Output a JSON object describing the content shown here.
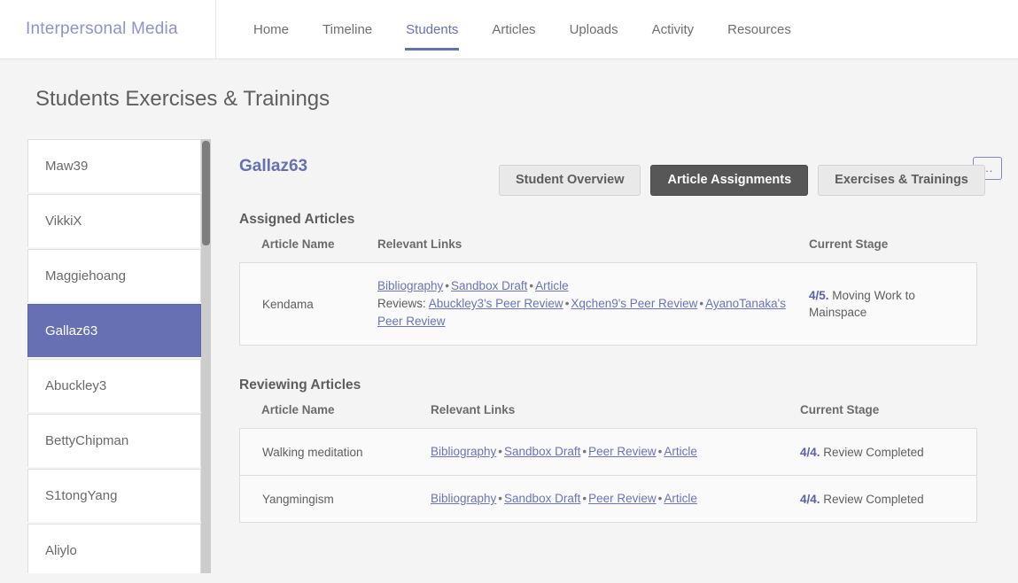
{
  "navbar": {
    "brand": "Interpersonal Media",
    "links": [
      {
        "label": "Home",
        "active": false
      },
      {
        "label": "Timeline",
        "active": false
      },
      {
        "label": "Students",
        "active": true
      },
      {
        "label": "Articles",
        "active": false
      },
      {
        "label": "Uploads",
        "active": false
      },
      {
        "label": "Activity",
        "active": false
      },
      {
        "label": "Resources",
        "active": false
      }
    ],
    "accent_color": "#6770b3"
  },
  "page": {
    "title": "Students Exercises & Trainings",
    "tabs": [
      {
        "label": "Student Overview",
        "active": false
      },
      {
        "label": "Article Assignments",
        "active": true
      },
      {
        "label": "Exercises & Trainings",
        "active": false
      }
    ]
  },
  "sidebar": {
    "students": [
      {
        "name": "Maw39",
        "selected": false
      },
      {
        "name": "VikkiX",
        "selected": false
      },
      {
        "name": "Maggiehoang",
        "selected": false
      },
      {
        "name": "Gallaz63",
        "selected": true
      },
      {
        "name": "Abuckley3",
        "selected": false
      },
      {
        "name": "BettyChipman",
        "selected": false
      },
      {
        "name": "S1tongYang",
        "selected": false
      },
      {
        "name": "Aliylo",
        "selected": false
      }
    ]
  },
  "detail": {
    "student_name": "Gallaz63",
    "more_button_label": "...",
    "assigned": {
      "section_title": "Assigned Articles",
      "headers": {
        "name": "Article Name",
        "links": "Relevant Links",
        "stage": "Current Stage"
      },
      "rows": [
        {
          "name": "Kendama",
          "links": [
            "Bibliography",
            "Sandbox Draft",
            "Article"
          ],
          "reviews_label": "Reviews:",
          "reviews": [
            "Abuckley3's Peer Review",
            "Xqchen9's Peer Review",
            "AyanoTanaka's Peer Review"
          ],
          "stage_number": "4/5.",
          "stage_text": "Moving Work to Mainspace"
        }
      ]
    },
    "reviewing": {
      "section_title": "Reviewing Articles",
      "headers": {
        "name": "Article Name",
        "links": "Relevant Links",
        "stage": "Current Stage"
      },
      "rows": [
        {
          "name": "Walking meditation",
          "links": [
            "Bibliography",
            "Sandbox Draft",
            "Peer Review",
            "Article"
          ],
          "stage_number": "4/4.",
          "stage_text": "Review Completed"
        },
        {
          "name": "Yangmingism",
          "links": [
            "Bibliography",
            "Sandbox Draft",
            "Peer Review",
            "Article"
          ],
          "stage_number": "4/4.",
          "stage_text": "Review Completed"
        }
      ]
    }
  }
}
